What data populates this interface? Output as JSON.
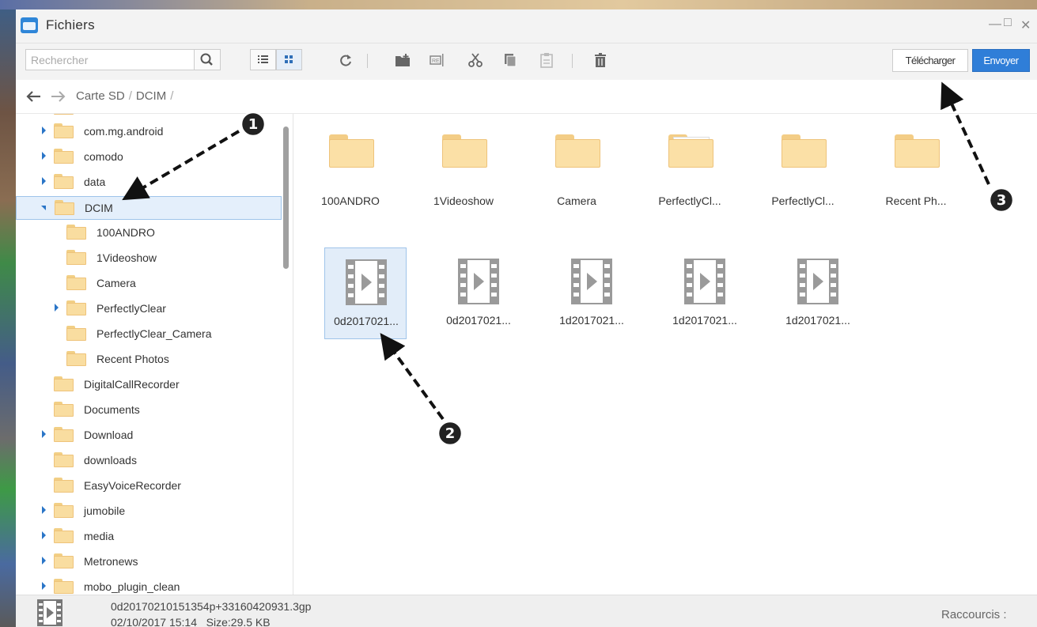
{
  "window": {
    "title": "Fichiers"
  },
  "toolbar": {
    "search_placeholder": "Rechercher",
    "download_label": "Télécharger",
    "send_label": "Envoyer"
  },
  "breadcrumb": {
    "items": [
      "Carte SD",
      "DCIM"
    ]
  },
  "tree": {
    "items": [
      {
        "label": "com.mg.android",
        "level": 0,
        "expander": "closed"
      },
      {
        "label": "comodo",
        "level": 0,
        "expander": "closed"
      },
      {
        "label": "data",
        "level": 0,
        "expander": "closed"
      },
      {
        "label": "DCIM",
        "level": 0,
        "expander": "open",
        "selected": true
      },
      {
        "label": "100ANDRO",
        "level": 1,
        "expander": "none"
      },
      {
        "label": "1Videoshow",
        "level": 1,
        "expander": "none"
      },
      {
        "label": "Camera",
        "level": 1,
        "expander": "none"
      },
      {
        "label": "PerfectlyClear",
        "level": 1,
        "expander": "closed"
      },
      {
        "label": "PerfectlyClear_Camera",
        "level": 1,
        "expander": "none"
      },
      {
        "label": "Recent Photos",
        "level": 1,
        "expander": "none"
      },
      {
        "label": "DigitalCallRecorder",
        "level": 0,
        "expander": "none"
      },
      {
        "label": "Documents",
        "level": 0,
        "expander": "none"
      },
      {
        "label": "Download",
        "level": 0,
        "expander": "closed"
      },
      {
        "label": "downloads",
        "level": 0,
        "expander": "none"
      },
      {
        "label": "EasyVoiceRecorder",
        "level": 0,
        "expander": "none"
      },
      {
        "label": "jumobile",
        "level": 0,
        "expander": "closed"
      },
      {
        "label": "media",
        "level": 0,
        "expander": "closed"
      },
      {
        "label": "Metronews",
        "level": 0,
        "expander": "closed"
      },
      {
        "label": "mobo_plugin_clean",
        "level": 0,
        "expander": "closed"
      }
    ]
  },
  "grid": {
    "folders": [
      {
        "label": "100ANDRO"
      },
      {
        "label": "1Videoshow"
      },
      {
        "label": "Camera"
      },
      {
        "label": "PerfectlyCl..."
      },
      {
        "label": "PerfectlyCl..."
      },
      {
        "label": "Recent Ph..."
      }
    ],
    "files": [
      {
        "label": "0d2017021...",
        "selected": true
      },
      {
        "label": "0d2017021..."
      },
      {
        "label": "1d2017021..."
      },
      {
        "label": "1d2017021..."
      },
      {
        "label": "1d2017021..."
      }
    ]
  },
  "status": {
    "file_name": "0d20170210151354p+33160420931.3gp",
    "file_meta": "02/10/2017 15:14   Size:29.5 KB",
    "shortcuts_label": "Raccourcis :"
  },
  "annotations": [
    "1",
    "2",
    "3"
  ],
  "colors": {
    "accent": "#2f7ed8",
    "folder": "#f9dda0",
    "selection": "#e4effb"
  }
}
